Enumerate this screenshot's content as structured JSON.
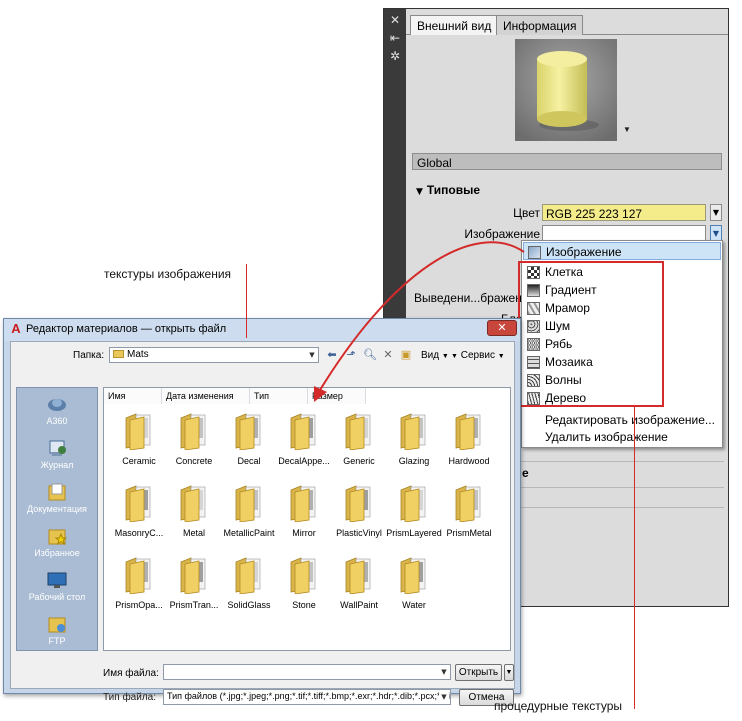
{
  "palette": {
    "tabs": [
      "Внешний вид",
      "Информация"
    ],
    "material_name": "Global",
    "section_title": "Типовые",
    "color_label": "Цвет",
    "color_value": "RGB 225 223 127",
    "image_label": "Изображение",
    "image_fade_label": "Выведени...бражения",
    "glossiness_partial": "Блес",
    "partial_heading": "е"
  },
  "dropdown": {
    "selected": "Изображение",
    "procedural": [
      "Клетка",
      "Градиент",
      "Мрамор",
      "Шум",
      "Рябь",
      "Мозаика",
      "Волны",
      "Дерево"
    ],
    "actions": [
      "Редактировать изображение...",
      "Удалить изображение"
    ]
  },
  "dialog": {
    "title": "Редактор материалов — открыть файл",
    "folder_label": "Папка:",
    "folder_value": "Mats",
    "view_label": "Вид",
    "tools_label": "Сервис",
    "places": [
      "A360",
      "Журнал",
      "Документация",
      "Избранное",
      "Рабочий стол",
      "FTP"
    ],
    "columns": [
      "Имя",
      "Дата изменения",
      "Тип",
      "Размер"
    ],
    "files": [
      "Ceramic",
      "Concrete",
      "Decal",
      "DecalAppe...",
      "Generic",
      "Glazing",
      "Hardwood",
      "MasonryC...",
      "Metal",
      "MetallicPaint",
      "Mirror",
      "PlasticVinyl",
      "PrismLayered",
      "PrismMetal",
      "PrismOpa...",
      "PrismTran...",
      "SolidGlass",
      "Stone",
      "WallPaint",
      "Water"
    ],
    "filename_label": "Имя файла:",
    "filename_value": "",
    "filetype_label": "Тип файла:",
    "filetype_value": "Тип файлов  (*.jpg;*.jpeg;*.png;*.tif;*.tiff;*.bmp;*.exr;*.hdr;*.dib;*.pcx;*.gif;*.tga;*",
    "open_label": "Открыть",
    "cancel_label": "Отмена"
  },
  "annotations": {
    "image_textures": "текстуры изображения",
    "procedural_textures": "процедурные текстуры"
  },
  "colors": {
    "highlight_red": "#d42a2a",
    "color_swatch": "#f4ec8a",
    "selection_blue": "#cde4f7"
  }
}
